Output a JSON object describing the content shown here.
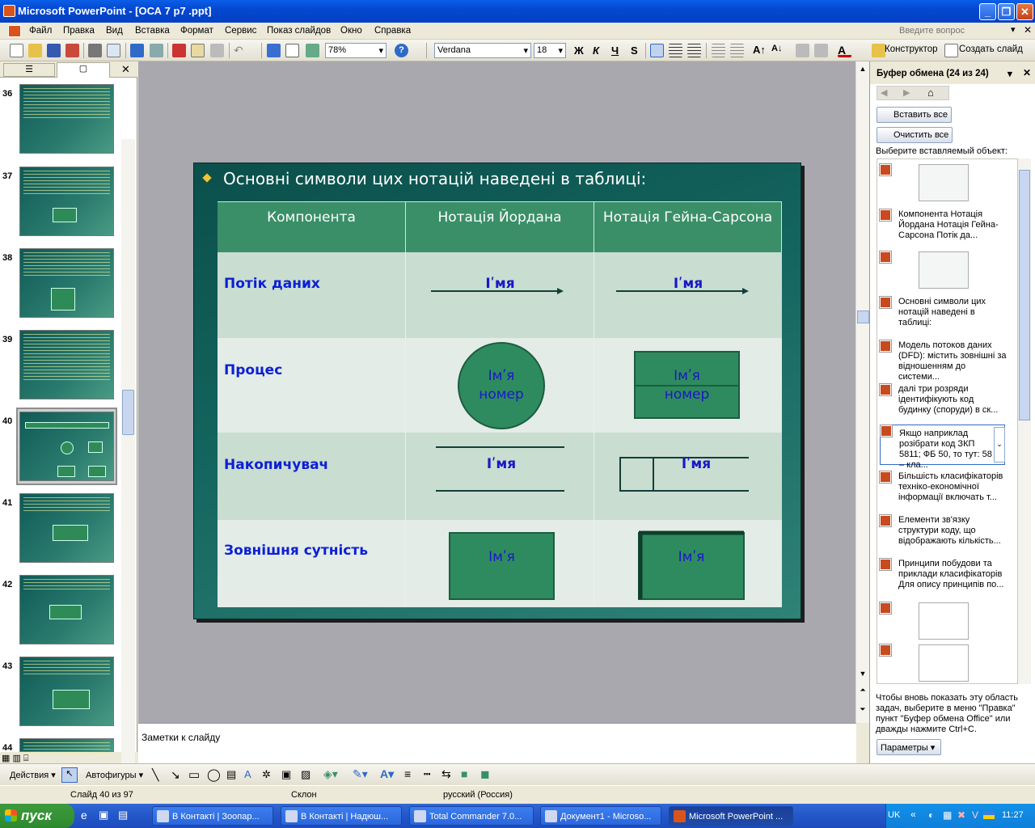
{
  "window": {
    "title": "Microsoft PowerPoint - [ОСА 7  р7 .ppt]"
  },
  "menu": [
    "Файл",
    "Правка",
    "Вид",
    "Вставка",
    "Формат",
    "Сервис",
    "Показ слайдов",
    "Окно",
    "Справка"
  ],
  "ask_placeholder": "Введите вопрос",
  "toolbar": {
    "zoom": "78%",
    "font": "Verdana",
    "size": "18",
    "bold": "Ж",
    "italic": "К",
    "underline": "Ч",
    "shadow": "S",
    "designer": "Конструктор",
    "new_slide": "Создать слайд"
  },
  "outline": {
    "slides": [
      "36",
      "37",
      "38",
      "39",
      "40",
      "41",
      "42",
      "43",
      "44"
    ]
  },
  "slide": {
    "heading": "Основні символи цих нотацій наведені в таблиці:",
    "headers": [
      "Компонента",
      "Нотація Йордана",
      "Нотація Гейна-Сарсона"
    ],
    "rows": [
      {
        "label": "Потік даних",
        "yordan": "Iʹмя",
        "gane": "Iʹмя"
      },
      {
        "label": "Процес",
        "yordan_1": "Імʹя",
        "yordan_2": "номер",
        "gane_1": "Імʹя",
        "gane_2": "номер"
      },
      {
        "label": "Накопичувач",
        "yordan": "Iʹмя",
        "gane": "Iʹмя"
      },
      {
        "label": "Зовнішня сутність",
        "yordan": "Імʹя",
        "gane": "Імʹя"
      }
    ]
  },
  "notes": {
    "placeholder": "Заметки к слайду"
  },
  "taskpane": {
    "title": "Буфер обмена (24 из 24)",
    "paste_all": "Вставить все",
    "clear_all": "Очистить все",
    "prompt": "Выберите вставляемый объект:",
    "items": [
      "Компонента Нотація Йордана Нотація Гейна-Сарсона Потік да...",
      "Основні символи цих нотацій наведені в таблиці:",
      "Модель потоков даних (DFD): містить зовнішні за відношенням до системи...",
      "далі три розряди ідентифікують код будинку (споруди) в ск...",
      "Якщо наприклад розібрати код ЗКП 5811; ФБ 50, то тут: 58 – кла...",
      "Більшість класифікаторів техніко-економічної інформації включать т...",
      "Елементи зв'язку структури коду, що відображають кількість...",
      "Принципи побудови та приклади класифікаторів Для опису принципів по..."
    ],
    "hint": "Чтобы вновь показать эту область задач, выберите в меню \"Правка\" пункт \"Буфер обмена Office\" или дважды нажмите Ctrl+C.",
    "options": "Параметры"
  },
  "drawbar": {
    "actions": "Действия",
    "autoshapes": "Автофигуры"
  },
  "status": {
    "slide": "Слайд 40 из 97",
    "design": "Склон",
    "lang": "русский (Россия)"
  },
  "taskbar": {
    "start": "пуск",
    "tasks": [
      "В Контакті | Зоопар...",
      "В Контакті | Надюш...",
      "Total Commander 7.0...",
      "Документ1 - Microso...",
      "Microsoft PowerPoint ..."
    ],
    "lang": "UK",
    "clock": "11:27"
  }
}
